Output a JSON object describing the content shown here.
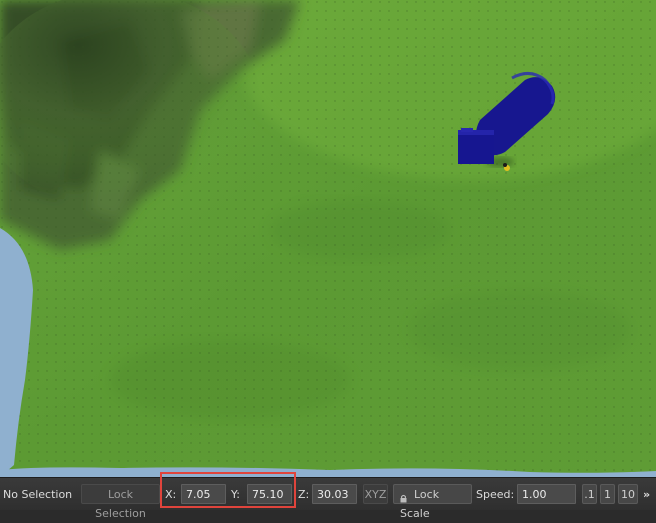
{
  "viewport": {
    "scene": "3d-terrain-view",
    "colors": {
      "grass": "#5e9a33",
      "mountain": "#3f5a2a",
      "water": "#8fb0cf",
      "object": "#17178f"
    }
  },
  "toolbar": {
    "selection_status": "No Selection",
    "lock_selection_label": "Lock Selection",
    "x_label": "X:",
    "x_value": "7.05",
    "y_label": "Y:",
    "y_value": "75.10",
    "z_label": "Z:",
    "z_value": "30.03",
    "xyz_label": "XYZ",
    "lock_icon": "lock-icon",
    "lock_scale_label": "Lock Scale",
    "speed_label": "Speed:",
    "speed_value": "1.00",
    "speed_presets": [
      ".1",
      "1",
      "10"
    ],
    "more_label": "»"
  }
}
